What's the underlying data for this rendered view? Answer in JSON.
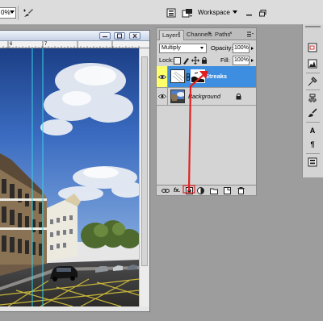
{
  "options_bar": {
    "zoom_value": "0%",
    "workspace_label": "Workspace"
  },
  "document": {
    "ruler_marks": [
      "6",
      "7"
    ]
  },
  "layers_panel": {
    "tabs": [
      {
        "label": "Layers"
      },
      {
        "label": "Channels"
      },
      {
        "label": "Paths"
      }
    ],
    "blend_mode": "Multiply",
    "opacity_label": "Opacity:",
    "opacity_value": "100%",
    "lock_label": "Lock:",
    "fill_label": "Fill:",
    "fill_value": "100%",
    "layers": [
      {
        "name": "Streaks",
        "selected": true,
        "visible": true,
        "has_mask": true
      },
      {
        "name": "Background",
        "selected": false,
        "visible": true,
        "locked": true
      }
    ]
  },
  "right_toolbar": {
    "type_tool_label": "A",
    "paragraph_label": "¶"
  },
  "colors": {
    "selected_layer": "#3d8ee0",
    "annotation_arrow": "#e02020",
    "guide_line": "#37d0e6"
  }
}
